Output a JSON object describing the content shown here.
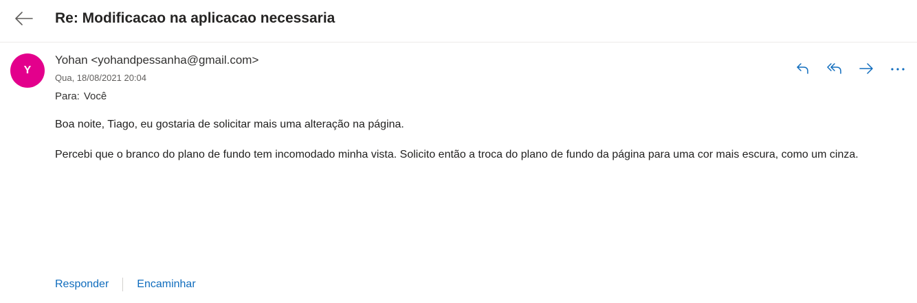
{
  "email": {
    "subject": "Re: Modificacao na aplicacao necessaria",
    "sender": {
      "initial": "Y",
      "display": "Yohan <yohandpessanha@gmail.com>",
      "avatar_color": "#e3008c"
    },
    "date": "Qua, 18/08/2021 20:04",
    "to_label": "Para:",
    "to_value": "Você",
    "body": {
      "paragraph1": "Boa noite, Tiago, eu gostaria de solicitar mais uma alteração na página.",
      "paragraph2": "Percebi que o branco do plano de fundo tem incomodado minha vista. Solicito então a troca do plano de fundo da página para uma cor mais escura, como um cinza."
    }
  },
  "toolbar": {
    "icons": [
      "back-arrow-icon",
      "reply-icon",
      "reply-all-icon",
      "forward-icon",
      "more-icon"
    ],
    "icon_color": "#0f6cbd"
  },
  "footer": {
    "reply_label": "Responder",
    "forward_label": "Encaminhar"
  }
}
